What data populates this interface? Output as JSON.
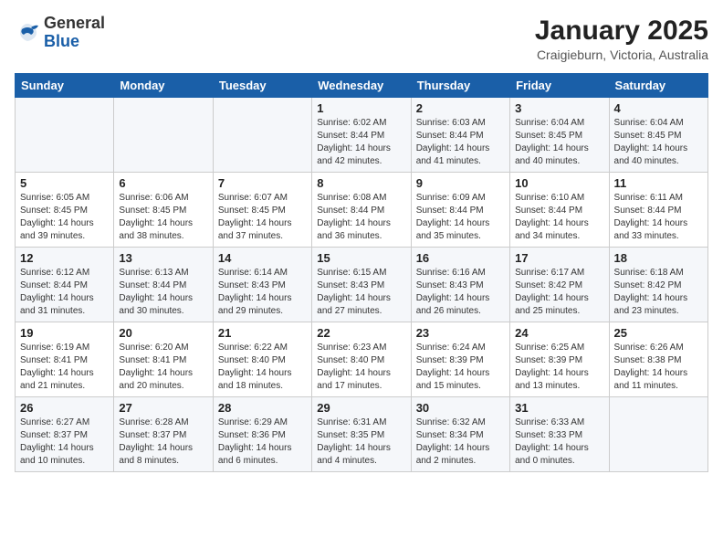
{
  "header": {
    "logo_general": "General",
    "logo_blue": "Blue",
    "title": "January 2025",
    "location": "Craigieburn, Victoria, Australia"
  },
  "calendar": {
    "weekdays": [
      "Sunday",
      "Monday",
      "Tuesday",
      "Wednesday",
      "Thursday",
      "Friday",
      "Saturday"
    ],
    "weeks": [
      [
        {
          "day": "",
          "info": ""
        },
        {
          "day": "",
          "info": ""
        },
        {
          "day": "",
          "info": ""
        },
        {
          "day": "1",
          "info": "Sunrise: 6:02 AM\nSunset: 8:44 PM\nDaylight: 14 hours\nand 42 minutes."
        },
        {
          "day": "2",
          "info": "Sunrise: 6:03 AM\nSunset: 8:44 PM\nDaylight: 14 hours\nand 41 minutes."
        },
        {
          "day": "3",
          "info": "Sunrise: 6:04 AM\nSunset: 8:45 PM\nDaylight: 14 hours\nand 40 minutes."
        },
        {
          "day": "4",
          "info": "Sunrise: 6:04 AM\nSunset: 8:45 PM\nDaylight: 14 hours\nand 40 minutes."
        }
      ],
      [
        {
          "day": "5",
          "info": "Sunrise: 6:05 AM\nSunset: 8:45 PM\nDaylight: 14 hours\nand 39 minutes."
        },
        {
          "day": "6",
          "info": "Sunrise: 6:06 AM\nSunset: 8:45 PM\nDaylight: 14 hours\nand 38 minutes."
        },
        {
          "day": "7",
          "info": "Sunrise: 6:07 AM\nSunset: 8:45 PM\nDaylight: 14 hours\nand 37 minutes."
        },
        {
          "day": "8",
          "info": "Sunrise: 6:08 AM\nSunset: 8:44 PM\nDaylight: 14 hours\nand 36 minutes."
        },
        {
          "day": "9",
          "info": "Sunrise: 6:09 AM\nSunset: 8:44 PM\nDaylight: 14 hours\nand 35 minutes."
        },
        {
          "day": "10",
          "info": "Sunrise: 6:10 AM\nSunset: 8:44 PM\nDaylight: 14 hours\nand 34 minutes."
        },
        {
          "day": "11",
          "info": "Sunrise: 6:11 AM\nSunset: 8:44 PM\nDaylight: 14 hours\nand 33 minutes."
        }
      ],
      [
        {
          "day": "12",
          "info": "Sunrise: 6:12 AM\nSunset: 8:44 PM\nDaylight: 14 hours\nand 31 minutes."
        },
        {
          "day": "13",
          "info": "Sunrise: 6:13 AM\nSunset: 8:44 PM\nDaylight: 14 hours\nand 30 minutes."
        },
        {
          "day": "14",
          "info": "Sunrise: 6:14 AM\nSunset: 8:43 PM\nDaylight: 14 hours\nand 29 minutes."
        },
        {
          "day": "15",
          "info": "Sunrise: 6:15 AM\nSunset: 8:43 PM\nDaylight: 14 hours\nand 27 minutes."
        },
        {
          "day": "16",
          "info": "Sunrise: 6:16 AM\nSunset: 8:43 PM\nDaylight: 14 hours\nand 26 minutes."
        },
        {
          "day": "17",
          "info": "Sunrise: 6:17 AM\nSunset: 8:42 PM\nDaylight: 14 hours\nand 25 minutes."
        },
        {
          "day": "18",
          "info": "Sunrise: 6:18 AM\nSunset: 8:42 PM\nDaylight: 14 hours\nand 23 minutes."
        }
      ],
      [
        {
          "day": "19",
          "info": "Sunrise: 6:19 AM\nSunset: 8:41 PM\nDaylight: 14 hours\nand 21 minutes."
        },
        {
          "day": "20",
          "info": "Sunrise: 6:20 AM\nSunset: 8:41 PM\nDaylight: 14 hours\nand 20 minutes."
        },
        {
          "day": "21",
          "info": "Sunrise: 6:22 AM\nSunset: 8:40 PM\nDaylight: 14 hours\nand 18 minutes."
        },
        {
          "day": "22",
          "info": "Sunrise: 6:23 AM\nSunset: 8:40 PM\nDaylight: 14 hours\nand 17 minutes."
        },
        {
          "day": "23",
          "info": "Sunrise: 6:24 AM\nSunset: 8:39 PM\nDaylight: 14 hours\nand 15 minutes."
        },
        {
          "day": "24",
          "info": "Sunrise: 6:25 AM\nSunset: 8:39 PM\nDaylight: 14 hours\nand 13 minutes."
        },
        {
          "day": "25",
          "info": "Sunrise: 6:26 AM\nSunset: 8:38 PM\nDaylight: 14 hours\nand 11 minutes."
        }
      ],
      [
        {
          "day": "26",
          "info": "Sunrise: 6:27 AM\nSunset: 8:37 PM\nDaylight: 14 hours\nand 10 minutes."
        },
        {
          "day": "27",
          "info": "Sunrise: 6:28 AM\nSunset: 8:37 PM\nDaylight: 14 hours\nand 8 minutes."
        },
        {
          "day": "28",
          "info": "Sunrise: 6:29 AM\nSunset: 8:36 PM\nDaylight: 14 hours\nand 6 minutes."
        },
        {
          "day": "29",
          "info": "Sunrise: 6:31 AM\nSunset: 8:35 PM\nDaylight: 14 hours\nand 4 minutes."
        },
        {
          "day": "30",
          "info": "Sunrise: 6:32 AM\nSunset: 8:34 PM\nDaylight: 14 hours\nand 2 minutes."
        },
        {
          "day": "31",
          "info": "Sunrise: 6:33 AM\nSunset: 8:33 PM\nDaylight: 14 hours\nand 0 minutes."
        },
        {
          "day": "",
          "info": ""
        }
      ]
    ]
  }
}
